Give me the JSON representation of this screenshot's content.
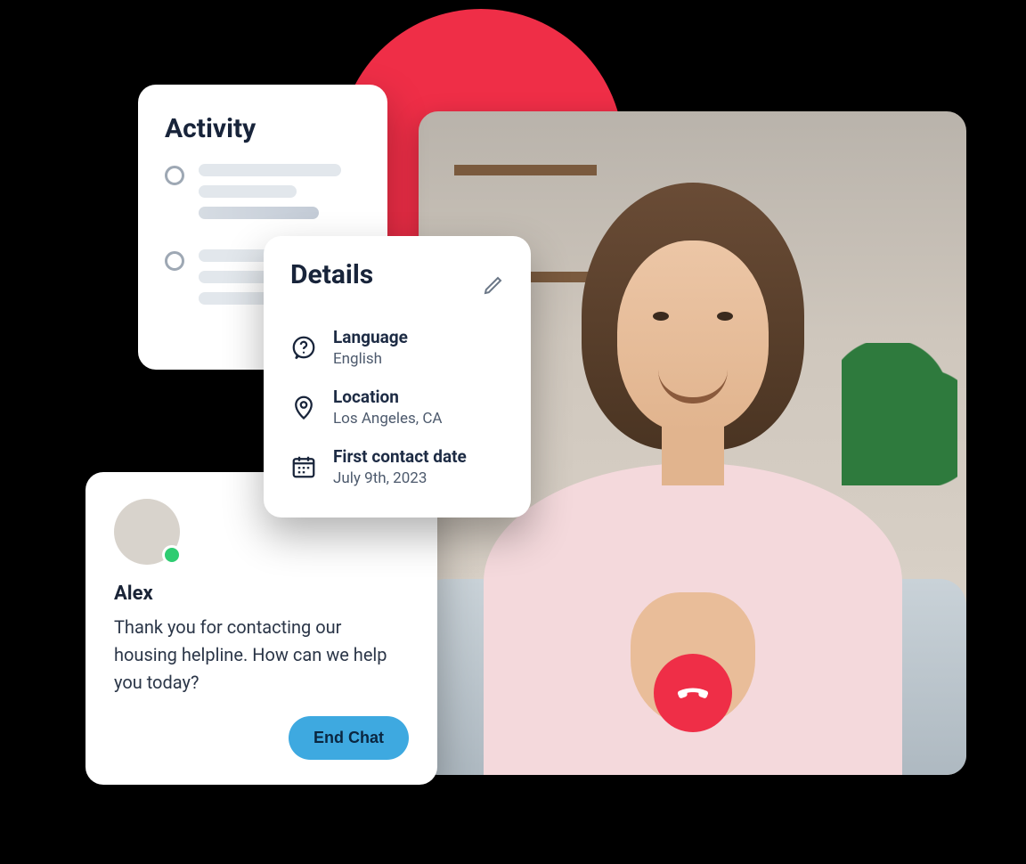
{
  "accent_color": "#ef2e47",
  "activity": {
    "title": "Activity"
  },
  "details": {
    "title": "Details",
    "items": [
      {
        "icon": "question-icon",
        "label": "Language",
        "value": "English"
      },
      {
        "icon": "pin-icon",
        "label": "Location",
        "value": "Los Angeles, CA"
      },
      {
        "icon": "calendar-icon",
        "label": "First contact date",
        "value": "July 9th, 2023"
      }
    ]
  },
  "chat": {
    "sender_name": "Alex",
    "message": "Thank you for contacting our housing helpline. How can we help you today?",
    "end_button": "End Chat",
    "presence": "online"
  },
  "call": {
    "hangup_label": "End call"
  }
}
